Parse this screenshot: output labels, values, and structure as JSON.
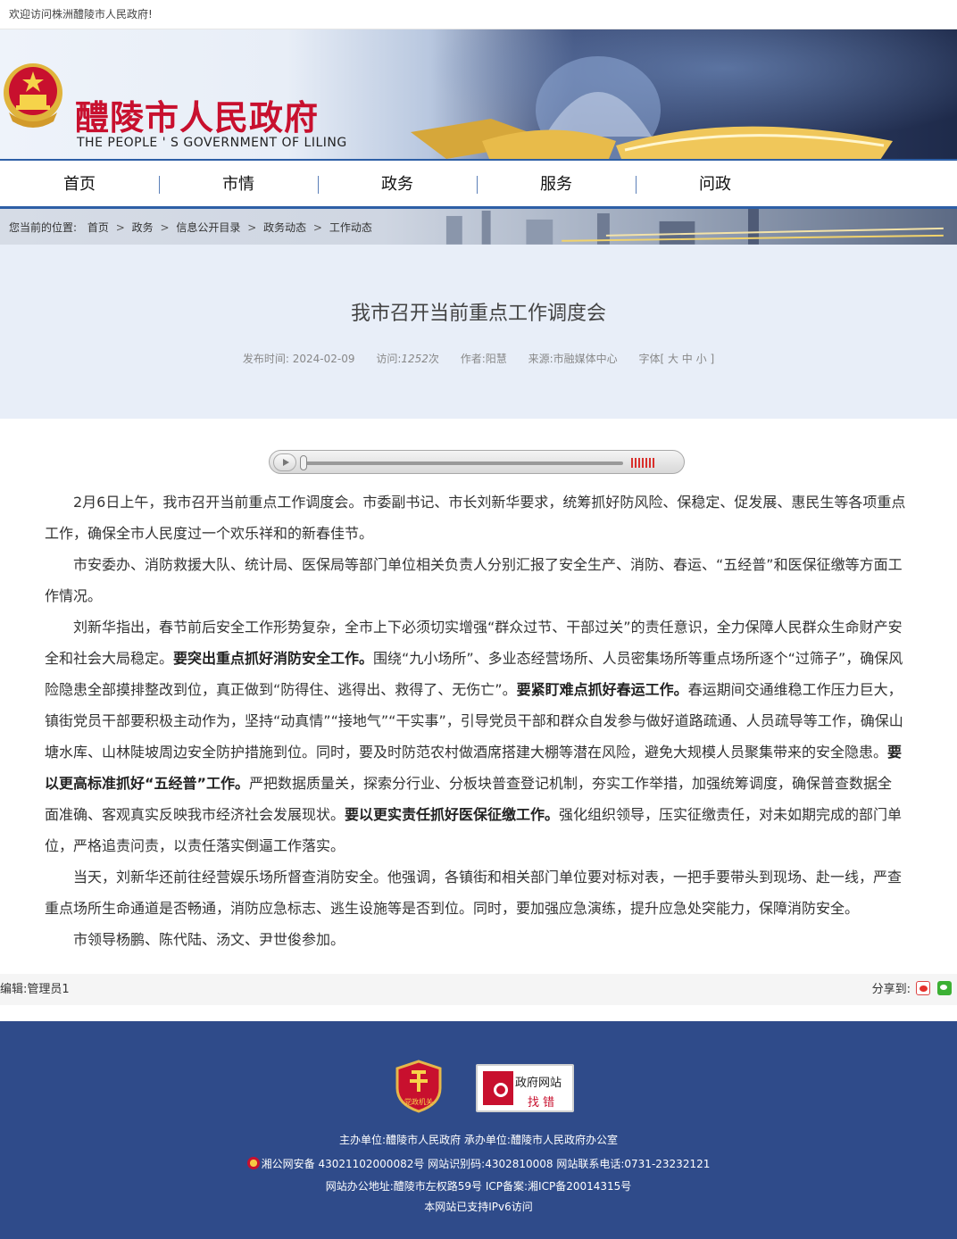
{
  "topbar": {
    "welcome": "欢迎访问株洲醴陵市人民政府!"
  },
  "header": {
    "title": "醴陵市人民政府",
    "subtitle": "THE PEOPLE ' S GOVERNMENT OF LILING"
  },
  "nav": {
    "items": [
      "首页",
      "市情",
      "政务",
      "服务",
      "问政"
    ]
  },
  "breadcrumb": {
    "prefix": "您当前的位置:",
    "items": [
      "首页",
      "政务",
      "信息公开目录",
      "政务动态",
      "工作动态"
    ]
  },
  "article": {
    "title": "我市召开当前重点工作调度会",
    "meta": {
      "date_label": "发布时间:",
      "date": "2024-02-09",
      "views_label": "访问:",
      "views": "1252",
      "views_unit": "次",
      "author": "作者:阳慧",
      "source": "来源:市融媒体中心",
      "font": "字体[ 大 中 小 ]"
    },
    "paragraphs": {
      "p1": "2月6日上午，我市召开当前重点工作调度会。市委副书记、市长刘新华要求，统筹抓好防风险、保稳定、促发展、惠民生等各项重点工作，确保全市人民度过一个欢乐祥和的新春佳节。",
      "p2": "市安委办、消防救援大队、统计局、医保局等部门单位相关负责人分别汇报了安全生产、消防、春运、“五经普”和医保征缴等方面工作情况。",
      "p3a": "刘新华指出，春节前后安全工作形势复杂，全市上下必须切实增强“群众过节、干部过关”的责任意识，全力保障人民群众生命财产安全和社会大局稳定。",
      "p3b": "要突出重点抓好消防安全工作。",
      "p3c": "围绕“九小场所”、多业态经营场所、人员密集场所等重点场所逐个“过筛子”，确保风险隐患全部摸排整改到位，真正做到“防得住、逃得出、救得了、无伤亡”。",
      "p3d": "要紧盯难点抓好春运工作。",
      "p3e": "春运期间交通维稳工作压力巨大，镇街党员干部要积极主动作为，坚持“动真情”“接地气”“干实事”，引导党员干部和群众自发参与做好道路疏通、人员疏导等工作，确保山塘水库、山林陡坡周边安全防护措施到位。同时，要及时防范农村做酒席搭建大棚等潜在风险，避免大规模人员聚集带来的安全隐患。",
      "p3f": "要以更高标准抓好“五经普”工作。",
      "p3g": "严把数据质量关，探索分行业、分板块普查登记机制，夯实工作举措，加强统筹调度，确保普查数据全面准确、客观真实反映我市经济社会发展现状。",
      "p3h": "要以更实责任抓好医保征缴工作。",
      "p3i": "强化组织领导，压实征缴责任，对未如期完成的部门单位，严格追责问责，以责任落实倒逼工作落实。",
      "p4": "当天，刘新华还前往经营娱乐场所督查消防安全。他强调，各镇街和相关部门单位要对标对表，一把手要带头到现场、赴一线，严查重点场所生命通道是否畅通，消防应急标志、逃生设施等是否到位。同时，要加强应急演练，提升应急处突能力，保障消防安全。",
      "p5": "市领导杨鹏、陈代陆、汤文、尹世俊参加。"
    }
  },
  "editor": {
    "label": "编辑:管理员1",
    "share_label": "分享到:"
  },
  "footer": {
    "badge_label": "党政机关",
    "jiucuo_top": "政府网站",
    "jiucuo_bottom": "找错",
    "line1": "主办单位:醴陵市人民政府 承办单位:醴陵市人民政府办公室",
    "line2": "湘公网安备 43021102000082号 网站识别码:4302810008 网站联系电话:0731-23232121",
    "line3": "网站办公地址:醴陵市左权路59号   ICP备案:湘ICP备20014315号",
    "line4": "本网站已支持IPv6访问"
  },
  "colors": {
    "brand_red": "#c8102e",
    "nav_blue": "#2d5fa6",
    "footer_blue": "#2f4b8a",
    "hero_bg": "#e8eef8"
  }
}
